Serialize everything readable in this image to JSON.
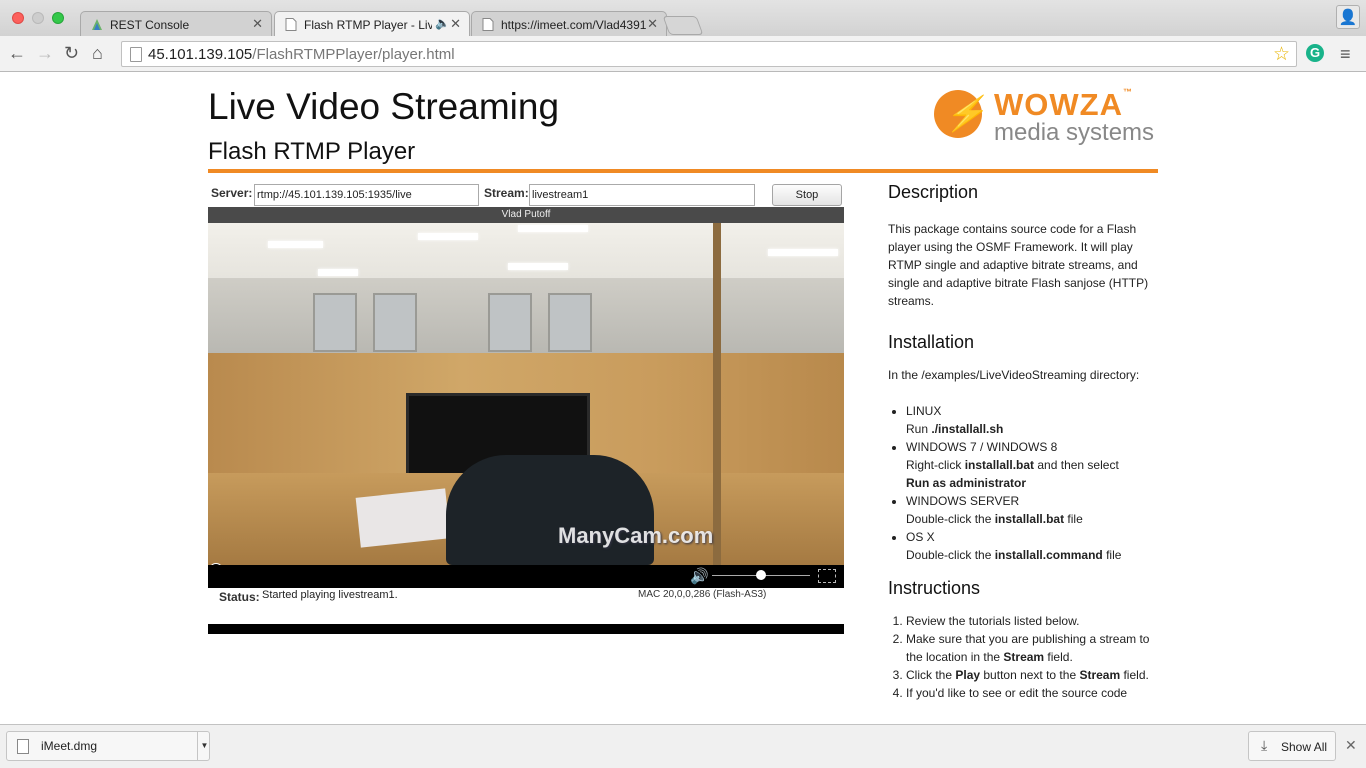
{
  "browser": {
    "tabs": [
      {
        "title": "REST Console",
        "active": false
      },
      {
        "title": "Flash RTMP Player - Live",
        "active": true,
        "audio_icon": "speaker-icon"
      },
      {
        "title": "https://imeet.com/Vlad4391",
        "active": false
      }
    ],
    "url_host": "45.101.139.105",
    "url_path": "/FlashRTMPPlayer/player.html",
    "extension_letter": "G"
  },
  "page": {
    "title": "Live Video Streaming",
    "subtitle": "Flash RTMP Player",
    "logo": {
      "top": "WOWZA",
      "tm": "™",
      "bottom": "media systems"
    },
    "accent_color": "#f08a24",
    "form": {
      "server_label": "Server:",
      "server_value": "rtmp://45.101.139.105:1935/live",
      "stream_label": "Stream:",
      "stream_value": "livestream1",
      "stop_label": "Stop"
    },
    "player": {
      "title": "Vlad Putoff",
      "watermark": "ManyCam.com",
      "volume_level": 0.5
    },
    "status_label": "Status:",
    "status_value": "Started playing livestream1.",
    "version": "MAC 20,0,0,286 (Flash-AS3)"
  },
  "side": {
    "description_heading": "Description",
    "description": "This package contains source code for a Flash player using the OSMF Framework. It will play RTMP single and adaptive bitrate streams, and single and adaptive bitrate Flash sanjose (HTTP) streams.",
    "installation_heading": "Installation",
    "installation_intro": "In the /examples/LiveVideoStreaming directory:",
    "install_items": [
      {
        "os": "LINUX",
        "pre": "Run ",
        "bold1": "./installall.sh",
        "mid": "",
        "bold2": "",
        "post": ""
      },
      {
        "os": "WINDOWS 7 / WINDOWS 8",
        "pre": "Right-click ",
        "bold1": "installall.bat",
        "mid": " and then select ",
        "bold2": "Run as administrator",
        "post": ""
      },
      {
        "os": "WINDOWS SERVER",
        "pre": "Double-click the ",
        "bold1": "installall.bat",
        "mid": "",
        "bold2": "",
        "post": " file"
      },
      {
        "os": "OS X",
        "pre": "Double-click the ",
        "bold1": "installall.command",
        "mid": "",
        "bold2": "",
        "post": " file"
      }
    ],
    "instructions_heading": "Instructions",
    "instructions": [
      {
        "pre": "Review the tutorials listed below.",
        "b1": "",
        "mid": "",
        "b2": "",
        "post": ""
      },
      {
        "pre": "Make sure that you are publishing a stream to the location in the ",
        "b1": "Stream",
        "mid": " field.",
        "b2": "",
        "post": ""
      },
      {
        "pre": "Click the ",
        "b1": "Play",
        "mid": " button next to the ",
        "b2": "Stream",
        "post": " field."
      },
      {
        "pre": "If you'd like to see or edit the source code",
        "b1": "",
        "mid": "",
        "b2": "",
        "post": ""
      }
    ]
  },
  "downloads": {
    "file_name": "iMeet.dmg",
    "show_all": "Show All"
  }
}
